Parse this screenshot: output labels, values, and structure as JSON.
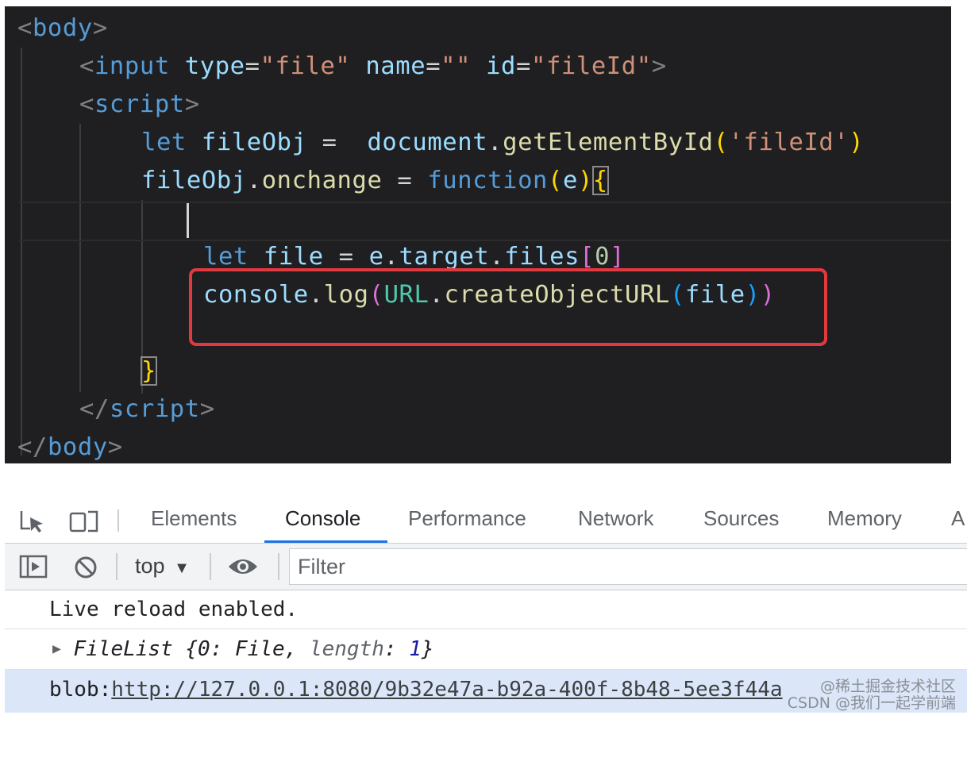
{
  "editor": {
    "lines": {
      "body_open": [
        "<",
        "body",
        ">"
      ],
      "input": [
        "<",
        "input",
        " ",
        "type",
        "=",
        "\"file\"",
        " ",
        "name",
        "=",
        "\"\"",
        " ",
        "id",
        "=",
        "\"fileId\"",
        ">"
      ],
      "script_open": [
        "<",
        "script",
        ">"
      ],
      "let_fileobj": [
        "let",
        " ",
        "fileObj",
        " =  ",
        "document",
        ".",
        "getElementById",
        "(",
        "'fileId'",
        ")"
      ],
      "onchange": [
        "fileObj",
        ".",
        "onchange",
        " = ",
        "function",
        "(",
        "e",
        ")",
        "{"
      ],
      "let_file": [
        "let",
        " ",
        "file",
        " = ",
        "e",
        ".",
        "target",
        ".",
        "files",
        "[",
        "0",
        "]"
      ],
      "console_log": [
        "console",
        ".",
        "log",
        "(",
        "URL",
        ".",
        "createObjectURL",
        "(",
        "file",
        ")",
        ")"
      ],
      "close_brace": [
        "}"
      ],
      "script_close": [
        "</",
        "script",
        ">"
      ],
      "body_close": [
        "</",
        "body",
        ">"
      ]
    },
    "highlight_color": "#e2393f"
  },
  "devtools": {
    "tabs": [
      "Elements",
      "Console",
      "Performance",
      "Network",
      "Sources",
      "Memory",
      "A"
    ],
    "active_tab": "Console",
    "icons": [
      "inspect-element-icon",
      "device-toolbar-icon",
      "sidebar-toggle-icon",
      "clear-console-icon",
      "eye-icon"
    ],
    "context": "top",
    "context_arrow": "▼",
    "filter_placeholder": "Filter",
    "messages": {
      "live_reload": "Live reload enabled.",
      "filelist": {
        "arrow": "▶",
        "name": "FileList ",
        "open": "{",
        "k0": "0",
        "colon1": ": ",
        "v0": "File",
        "comma": ", ",
        "klen": "length",
        "colon2": ": ",
        "vlen": "1",
        "close": "}"
      },
      "blob": {
        "prefix": "blob:",
        "url": "http://127.0.0.1:8080/9b32e47a-b92a-400f-8b48-5ee3f44a"
      }
    },
    "watermark": {
      "line1": "@稀土掘金技术社区",
      "line2": "CSDN @我们一起学前端"
    },
    "accent": "#1a73e8",
    "selected_bg": "#dbe6f8"
  }
}
